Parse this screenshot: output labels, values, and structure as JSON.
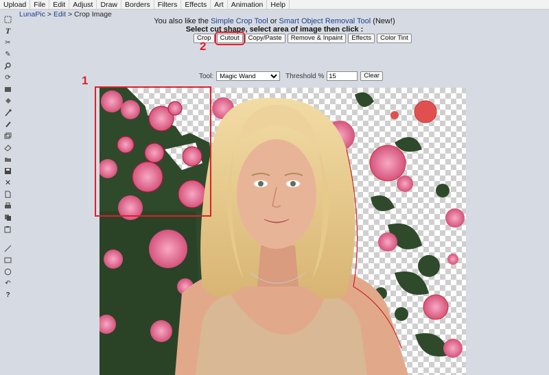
{
  "menu": [
    "Upload",
    "File",
    "Edit",
    "Adjust",
    "Draw",
    "Borders",
    "Filters",
    "Effects",
    "Art",
    "Animation",
    "Help"
  ],
  "breadcrumb": {
    "site": "LunaPic",
    "sep1": ">",
    "section": "Edit",
    "sep2": ">",
    "page": "Crop Image"
  },
  "promo": {
    "prefix": "You also like the ",
    "link1": "Simple Crop Tool",
    "middle": " or ",
    "link2": "Smart Object Removal Tool",
    "suffix": " (New!)"
  },
  "instruction": "Select cut shape, select area of image then click :",
  "actions": {
    "crop": "Crop",
    "cutout": "Cutout",
    "copy_paste": "Copy/Paste",
    "remove_inpaint": "Remove & Inpaint",
    "effects": "Effects",
    "color_tint": "Color Tint"
  },
  "toolrow": {
    "tool_label": "Tool:",
    "tool_value": "Magic Wand",
    "threshold_label": "Threshold %",
    "threshold_value": "15",
    "clear_label": "Clear"
  },
  "annotations": {
    "one": "1",
    "two": "2"
  },
  "toolbar_icons": [
    "select-rect-icon",
    "text-icon",
    "scissors-icon",
    "pencil-icon",
    "zoom-icon",
    "rotate-icon",
    "layers-icon",
    "fill-icon",
    "eyedropper-icon",
    "brush-icon",
    "clone-icon",
    "eraser-icon",
    "open-icon",
    "save-icon",
    "close-icon",
    "new-file-icon",
    "print-icon",
    "copy-icon",
    "paste-icon",
    "line-icon",
    "rectangle-icon",
    "ellipse-icon",
    "undo-icon",
    "help-icon"
  ],
  "colors": {
    "annotation": "#e01e2a",
    "link": "#1b3e8c",
    "background": "#d6dbe3"
  }
}
